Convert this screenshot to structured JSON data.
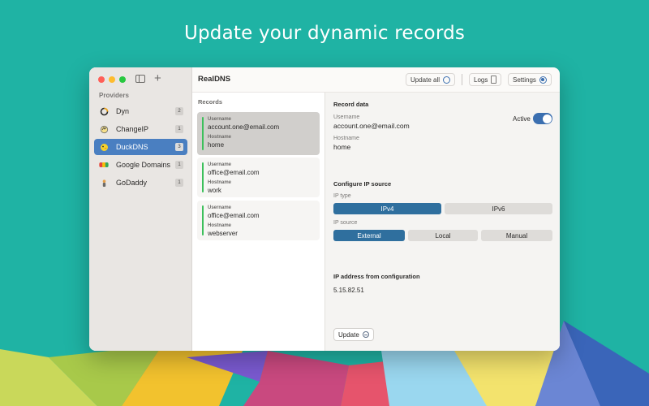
{
  "headline": "Update your dynamic records",
  "colors": {
    "background": "#1fb3a4",
    "accent": "#3b6fb0",
    "selected_provider": "#4a7fc1",
    "record_indicator": "#3cc05b",
    "segment_active": "#2f6f9e"
  },
  "window": {
    "title": "RealDNS",
    "traffic_lights": [
      "#ff5f57",
      "#febc2e",
      "#28c840"
    ]
  },
  "sidebar": {
    "section_label": "Providers",
    "items": [
      {
        "label": "Dyn",
        "count": "2",
        "icon": "dyn-icon",
        "selected": false
      },
      {
        "label": "ChangeIP",
        "count": "1",
        "icon": "changeip-icon",
        "selected": false
      },
      {
        "label": "DuckDNS",
        "count": "3",
        "icon": "duckdns-icon",
        "selected": true
      },
      {
        "label": "Google Domains",
        "count": "1",
        "icon": "google-domains-icon",
        "selected": false
      },
      {
        "label": "GoDaddy",
        "count": "1",
        "icon": "godaddy-icon",
        "selected": false
      }
    ]
  },
  "toolbar": {
    "update_all_label": "Update all",
    "logs_label": "Logs",
    "settings_label": "Settings"
  },
  "records": {
    "header": "Records",
    "username_label": "Username",
    "hostname_label": "Hostname",
    "items": [
      {
        "username": "account.one@email.com",
        "hostname": "home",
        "selected": true
      },
      {
        "username": "office@email.com",
        "hostname": "work",
        "selected": false
      },
      {
        "username": "office@email.com",
        "hostname": "webserver",
        "selected": false
      }
    ]
  },
  "detail": {
    "record_data_header": "Record data",
    "username_label": "Username",
    "username_value": "account.one@email.com",
    "hostname_label": "Hostname",
    "hostname_value": "home",
    "active_label": "Active",
    "active_on": true,
    "configure_header": "Configure IP source",
    "ip_type_label": "IP type",
    "ip_type_options": [
      "IPv4",
      "IPv6"
    ],
    "ip_type_selected": "IPv4",
    "ip_source_label": "IP source",
    "ip_source_options": [
      "External",
      "Local",
      "Manual"
    ],
    "ip_source_selected": "External",
    "ip_config_header": "IP address from configuration",
    "ip_value": "5.15.82.51",
    "update_label": "Update"
  }
}
